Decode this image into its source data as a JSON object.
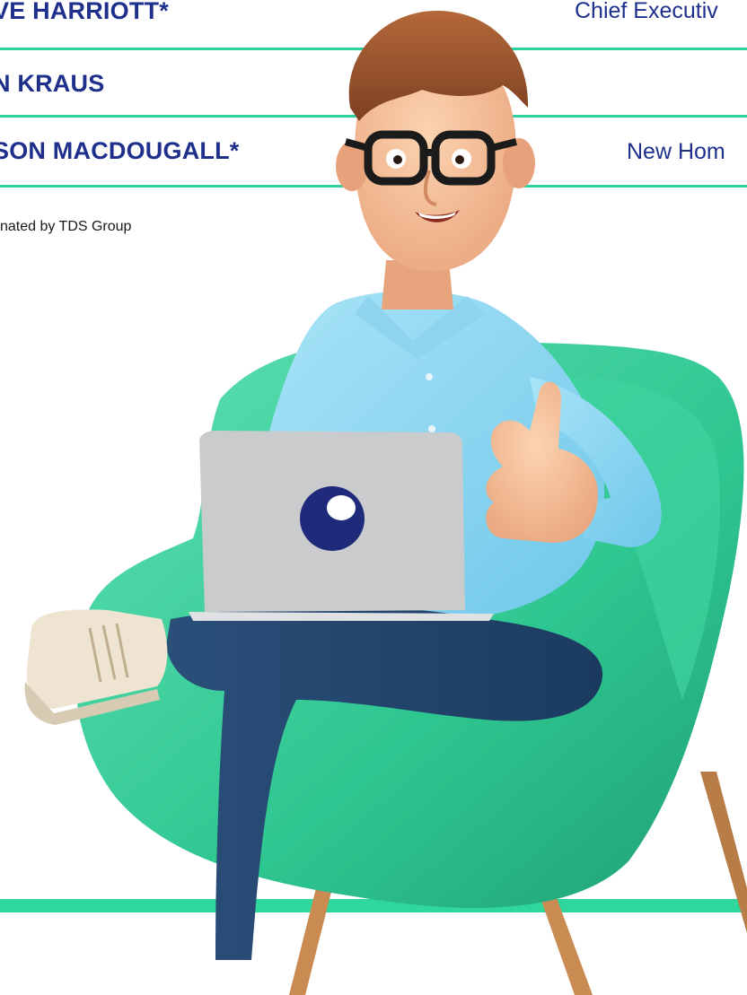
{
  "rows": [
    {
      "name": "VE HARRIOTT*",
      "role": "Chief Executiv"
    },
    {
      "name": "N KRAUS",
      "role": ""
    },
    {
      "name": "SON MACDOUGALL*",
      "role": "New Hom"
    }
  ],
  "footnote": "nated by TDS Group",
  "colors": {
    "accent_green": "#2fd1a0",
    "text_navy": "#1f2f8c"
  },
  "illustration": {
    "subject": "3d-character-with-laptop-in-armchair-icon",
    "laptop_logo": "tds-logo-icon"
  }
}
